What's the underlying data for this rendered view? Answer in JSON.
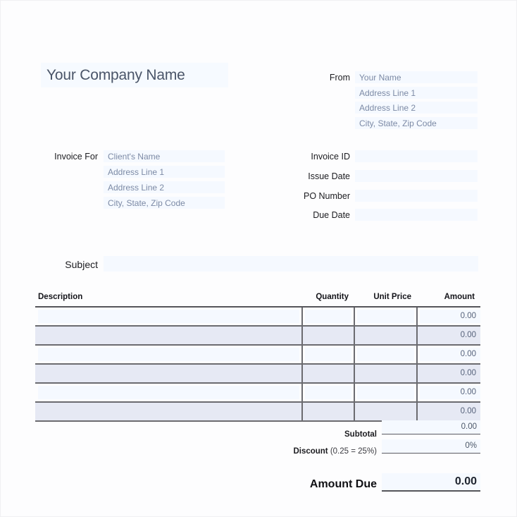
{
  "company": {
    "name_value": "Your Company Name"
  },
  "from": {
    "label": "From",
    "lines": [
      "Your Name",
      "Address Line 1",
      "Address Line 2",
      "City, State, Zip Code"
    ]
  },
  "invoice_for": {
    "label": "Invoice For",
    "lines": [
      "Client's Name",
      "Address Line 1",
      "Address Line 2",
      "City, State, Zip Code"
    ]
  },
  "meta": {
    "fields": [
      {
        "label": "Invoice ID",
        "value": ""
      },
      {
        "label": "Issue Date",
        "value": ""
      },
      {
        "label": "PO Number",
        "value": ""
      },
      {
        "label": "Due Date",
        "value": ""
      }
    ]
  },
  "subject": {
    "label": "Subject",
    "value": ""
  },
  "items": {
    "columns": [
      "Description",
      "Quantity",
      "Unit Price",
      "Amount"
    ],
    "rows": [
      {
        "description": "",
        "quantity": "",
        "unit_price": "",
        "amount": "0.00"
      },
      {
        "description": "",
        "quantity": "",
        "unit_price": "",
        "amount": "0.00"
      },
      {
        "description": "",
        "quantity": "",
        "unit_price": "",
        "amount": "0.00"
      },
      {
        "description": "",
        "quantity": "",
        "unit_price": "",
        "amount": "0.00"
      },
      {
        "description": "",
        "quantity": "",
        "unit_price": "",
        "amount": "0.00"
      },
      {
        "description": "",
        "quantity": "",
        "unit_price": "",
        "amount": "0.00"
      }
    ]
  },
  "totals": {
    "subtotal_label": "Subtotal",
    "subtotal_value": "0.00",
    "discount_label": "Discount",
    "discount_hint": " (0.25 = 25%)",
    "discount_value": "0%",
    "amount_due_label": "Amount Due",
    "amount_due_value": "0.00"
  },
  "colors": {
    "field_bg": "#f5f9ff",
    "row_shade": "#e6e9f4",
    "rule": "#6b6b70",
    "placeholder_text": "#7c8aa5",
    "page_bg": "#fdfdfe"
  }
}
